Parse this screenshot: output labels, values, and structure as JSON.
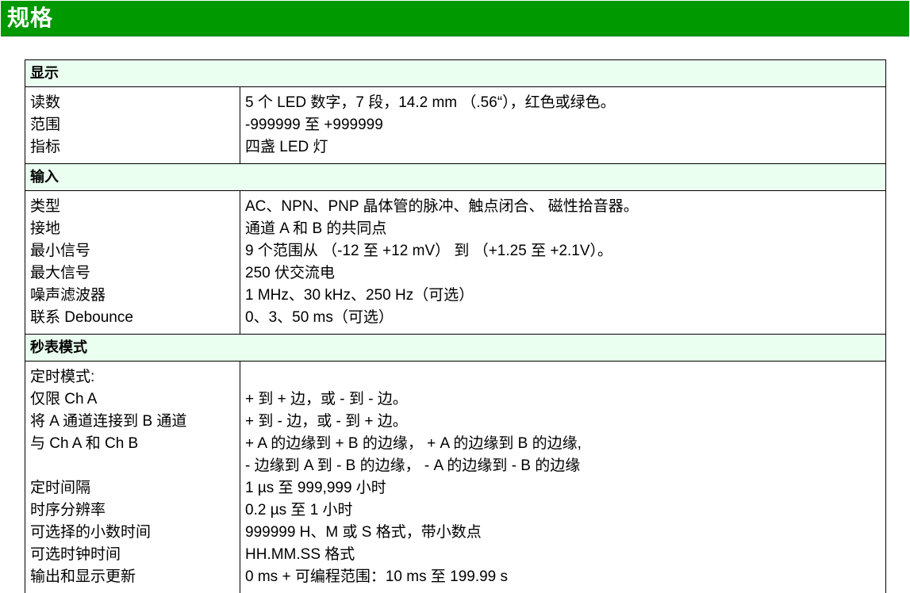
{
  "header": {
    "title": "规格"
  },
  "sections": {
    "display": {
      "title": "显示",
      "labels": [
        "读数",
        "范围",
        "指标"
      ],
      "values": [
        "5 个 LED 数字，7 段，14.2 mm （.56“），红色或绿色。",
        "-999999 至 +999999",
        "四盏 LED 灯"
      ]
    },
    "input": {
      "title": "输入",
      "labels": [
        "类型",
        "接地",
        "最小信号",
        "最大信号",
        "噪声滤波器",
        "联系 Debounce"
      ],
      "values": [
        "AC、NPN、PNP 晶体管的脉冲、触点闭合、 磁性拾音器。",
        "通道 A 和 B 的共同点",
        "9 个范围从 （-12 至 +12 mV） 到 （+1.25 至 +2.1V）。",
        "250 伏交流电",
        "1 MHz、30 kHz、250 Hz（可选）",
        "0、3、50 ms（可选）"
      ]
    },
    "timer": {
      "title": "秒表模式",
      "labels": [
        "定时模式:",
        "仅限 Ch A",
        "将 A 通道连接到 B 通道",
        "与 Ch A 和 Ch B",
        "",
        "定时间隔",
        "时序分辨率",
        "可选择的小数时间",
        "可选时钟时间",
        "输出和显示更新"
      ],
      "values": [
        "",
        "+ 到 + 边，或 - 到 - 边。",
        "+ 到 - 边，或 - 到 + 边。",
        "+ A 的边缘到 + B 的边缘， + A 的边缘到 B 的边缘,",
        "- 边缘到 A 到 - B 的边缘， - A 的边缘到 - B 的边缘",
        "1 µs 至 999,999 小时",
        "0.2 µs 至 1 小时",
        "999999 H、M 或 S 格式，带小数点",
        "HH.MM.SS 格式",
        "0 ms + 可编程范围：10 ms 至 199.99 s"
      ]
    }
  },
  "colors": {
    "header_bg": "#009900",
    "header_text": "#ffffff",
    "section_bg": "#eafff0",
    "border": "#000000"
  }
}
